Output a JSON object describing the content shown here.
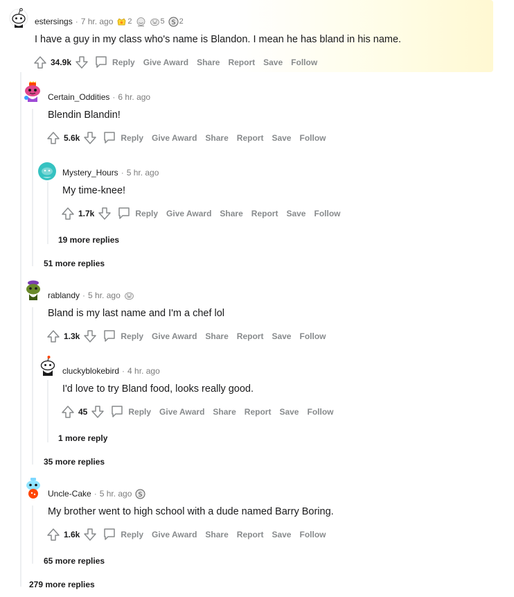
{
  "comments": [
    {
      "author": "estersings",
      "time": "7 hr. ago",
      "awards": [
        {
          "icon": "helpful-award-icon",
          "count": "2"
        },
        {
          "icon": "wholesome-award-icon",
          "count": ""
        },
        {
          "icon": "laughing-award-icon",
          "count": "5"
        },
        {
          "icon": "silver-award-icon",
          "count": "2"
        }
      ],
      "body": "I have a guy in my class who's name is Blandon. I mean he has bland in his name.",
      "score": "34.9k"
    },
    {
      "author": "Certain_Oddities",
      "time": "6 hr. ago",
      "awards": [],
      "body": "Blendin Blandin!",
      "score": "5.6k"
    },
    {
      "author": "Mystery_Hours",
      "time": "5 hr. ago",
      "awards": [],
      "body": "My time-knee!",
      "score": "1.7k"
    },
    {
      "author": "rablandy",
      "time": "5 hr. ago",
      "awards": [
        {
          "icon": "laughing-award-icon",
          "count": ""
        }
      ],
      "body": "Bland is my last name and I'm a chef lol",
      "score": "1.3k"
    },
    {
      "author": "cluckyblokebird",
      "time": "4 hr. ago",
      "awards": [],
      "body": "I'd love to try Bland food, looks really good.",
      "score": "45"
    },
    {
      "author": "Uncle-Cake",
      "time": "5 hr. ago",
      "awards": [
        {
          "icon": "silver-award-icon",
          "count": ""
        }
      ],
      "body": "My brother went to high school with a dude named Barry Boring.",
      "score": "1.6k"
    }
  ],
  "actions": {
    "reply": "Reply",
    "give_award": "Give Award",
    "share": "Share",
    "report": "Report",
    "save": "Save",
    "follow": "Follow"
  },
  "more_replies": {
    "mystery_hours": "19 more replies",
    "certain_oddities": "51 more replies",
    "cluckyblokebird": "1 more reply",
    "rablandy": "35 more replies",
    "uncle_cake": "65 more replies",
    "top": "279 more replies"
  },
  "colors": {
    "text": "#1a1a1b",
    "meta": "#7c7c7c",
    "action": "#878a8c",
    "thread_line": "#edeff1",
    "highlight": "#fff8d2"
  }
}
